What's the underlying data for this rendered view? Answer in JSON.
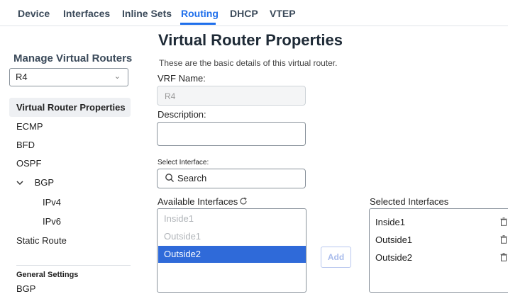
{
  "tabs": [
    {
      "label": "Device"
    },
    {
      "label": "Interfaces"
    },
    {
      "label": "Inline Sets"
    },
    {
      "label": "Routing"
    },
    {
      "label": "DHCP"
    },
    {
      "label": "VTEP"
    }
  ],
  "active_tab": "Routing",
  "sidebar": {
    "title": "Manage Virtual Routers",
    "router_select": {
      "value": "R4"
    },
    "items": [
      {
        "label": "Virtual Router Properties"
      },
      {
        "label": "ECMP"
      },
      {
        "label": "BFD"
      },
      {
        "label": "OSPF"
      },
      {
        "label": "BGP"
      },
      {
        "label": "IPv4"
      },
      {
        "label": "IPv6"
      },
      {
        "label": "Static Route"
      }
    ],
    "general_settings_title": "General Settings",
    "general_settings_items": [
      {
        "label": "BGP"
      }
    ]
  },
  "main": {
    "title": "Virtual Router Properties",
    "description": "These are the basic details of this virtual router.",
    "vrf_name_label": "VRF Name:",
    "vrf_name_value": "R4",
    "description_label": "Description:",
    "description_value": "",
    "select_interface_label": "Select Interface:",
    "search_placeholder": "Search",
    "available_label": "Available Interfaces",
    "available_interfaces": [
      {
        "name": "Inside1",
        "state": "disabled"
      },
      {
        "name": "Outside1",
        "state": "disabled"
      },
      {
        "name": "Outside2",
        "state": "selected"
      }
    ],
    "add_label": "Add",
    "selected_label": "Selected Interfaces",
    "selected_interfaces": [
      {
        "name": "Inside1"
      },
      {
        "name": "Outside1"
      },
      {
        "name": "Outside2"
      }
    ]
  },
  "colors": {
    "accent": "#1f6feb",
    "selected_row": "#2f6ad9"
  }
}
